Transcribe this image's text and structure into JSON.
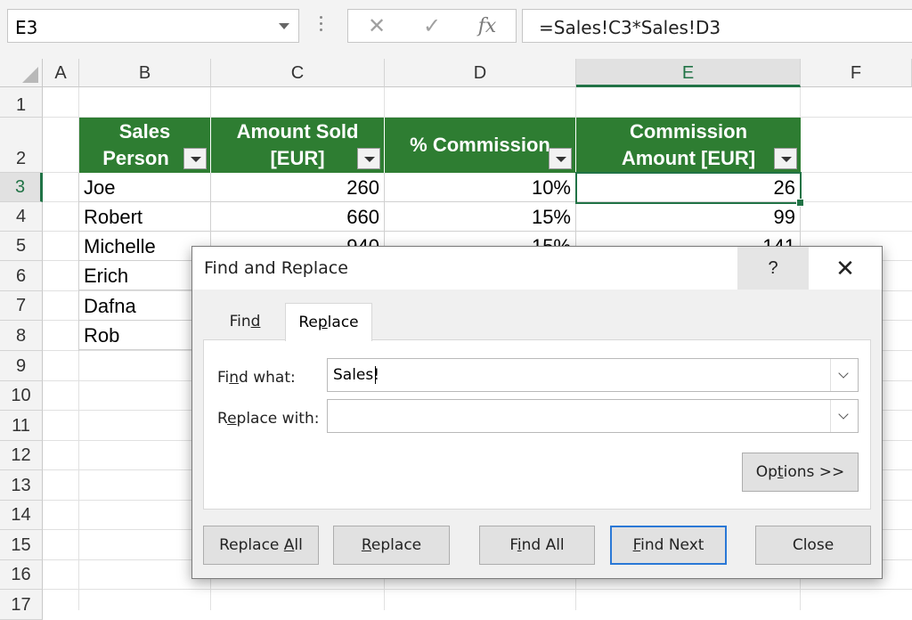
{
  "formula_bar": {
    "name_box": "E3",
    "cancel_icon": "✕",
    "enter_icon": "✓",
    "fx_label": "fx",
    "formula": "=Sales!C3*Sales!D3"
  },
  "grid": {
    "columns": [
      "A",
      "B",
      "C",
      "D",
      "E",
      "F"
    ],
    "active_column": "E",
    "rows": [
      "1",
      "2",
      "3",
      "4",
      "5",
      "6",
      "7",
      "8",
      "9",
      "10",
      "11",
      "12",
      "13",
      "14",
      "15",
      "16",
      "17"
    ],
    "active_row": "3",
    "table": {
      "headers": [
        {
          "line1": "Sales",
          "line2": "Person"
        },
        {
          "line1": "Amount Sold",
          "line2": "[EUR]"
        },
        {
          "line1": "% Commission",
          "line2": ""
        },
        {
          "line1": "Commission",
          "line2": "Amount [EUR]"
        }
      ],
      "rows": [
        [
          "Joe",
          "260",
          "10%",
          "26"
        ],
        [
          "Robert",
          "660",
          "15%",
          "99"
        ],
        [
          "Michelle",
          "940",
          "15%",
          "141"
        ],
        [
          "Erich",
          "",
          "",
          ""
        ],
        [
          "Dafna",
          "",
          "",
          ""
        ],
        [
          "Rob",
          "",
          "",
          ""
        ]
      ]
    },
    "header_color": "#2e7d32",
    "accent_color": "#217346"
  },
  "dialog": {
    "title": "Find and Replace",
    "help": "?",
    "close": "✕",
    "tabs": {
      "find": {
        "pre": "Fin",
        "key": "d",
        "post": ""
      },
      "replace": {
        "pre": "Re",
        "key": "p",
        "post": "lace"
      }
    },
    "find_what": {
      "pre": "Fi",
      "key": "n",
      "post": "d what:",
      "value": "Sales!"
    },
    "replace_with": {
      "pre": "R",
      "key": "e",
      "post": "place with:",
      "value": ""
    },
    "options": {
      "pre": "Op",
      "key": "t",
      "post": "ions >>"
    },
    "buttons": {
      "replace_all": {
        "pre": "Replace ",
        "key": "A",
        "post": "ll"
      },
      "replace": {
        "pre": "",
        "key": "R",
        "post": "eplace"
      },
      "find_all": {
        "pre": "F",
        "key": "i",
        "post": "nd All"
      },
      "find_next": {
        "pre": "",
        "key": "F",
        "post": "ind Next"
      },
      "close": "Close"
    }
  }
}
